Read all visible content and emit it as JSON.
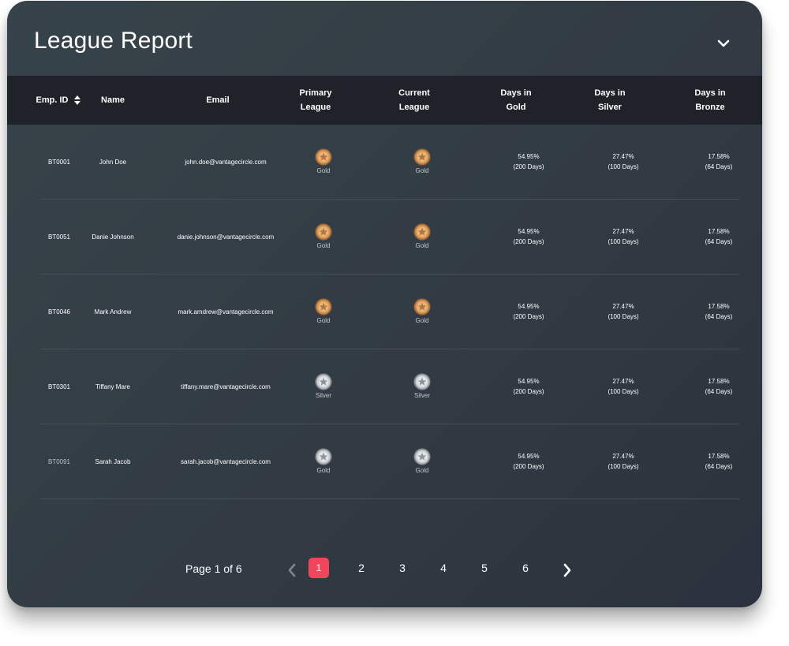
{
  "header": {
    "title": "League Report"
  },
  "columns": [
    {
      "label": "Emp. ID"
    },
    {
      "label": "Name"
    },
    {
      "label": "Email"
    },
    {
      "label": "Primary\nLeague"
    },
    {
      "label": "Current\nLeague"
    },
    {
      "label": "Days in\nGold"
    },
    {
      "label": "Days in\nSilver"
    },
    {
      "label": "Days in\nBronze"
    }
  ],
  "rows": [
    {
      "id": "BT0001",
      "name": "John Doe",
      "email": "john.doe@vantagecircle.com",
      "primary": "Gold",
      "primary_medal": "gold",
      "current": "Gold",
      "current_medal": "gold",
      "gold_pct": "54.95%",
      "gold_days": "(200 Days)",
      "silver_pct": "27.47%",
      "silver_days": "(100 Days)",
      "bronze_pct": "17.58%",
      "bronze_days": "(64 Days)"
    },
    {
      "id": "BT0051",
      "name": "Danie Johnson",
      "email": "danie.johnson@vantagecircle.com",
      "primary": "Gold",
      "primary_medal": "gold",
      "current": "Gold",
      "current_medal": "gold",
      "gold_pct": "54.95%",
      "gold_days": "(200 Days)",
      "silver_pct": "27.47%",
      "silver_days": "(100 Days)",
      "bronze_pct": "17.58%",
      "bronze_days": "(64 Days)"
    },
    {
      "id": "BT0046",
      "name": "Mark Andrew",
      "email": "mark.amdrew@vantagecircle.com",
      "primary": "Gold",
      "primary_medal": "gold",
      "current": "Gold",
      "current_medal": "gold",
      "gold_pct": "54.95%",
      "gold_days": "(200 Days)",
      "silver_pct": "27.47%",
      "silver_days": "(100 Days)",
      "bronze_pct": "17.58%",
      "bronze_days": "(64 Days)"
    },
    {
      "id": "BT0301",
      "name": "Tiffany Mare",
      "email": "tiffany.mare@vantagecircle.com",
      "primary": "Silver",
      "primary_medal": "silver",
      "current": "Silver",
      "current_medal": "silver",
      "gold_pct": "54.95%",
      "gold_days": "(200 Days)",
      "silver_pct": "27.47%",
      "silver_days": "(100 Days)",
      "bronze_pct": "17.58%",
      "bronze_days": "(64 Days)"
    },
    {
      "id": "BT0091",
      "name": "Sarah Jacob",
      "email": "sarah.jacob@vantagecircle.com",
      "primary": "Gold",
      "primary_medal": "silver",
      "current": "Gold",
      "current_medal": "silver",
      "gold_pct": "54.95%",
      "gold_days": "(200 Days)",
      "silver_pct": "27.47%",
      "silver_days": "(100 Days)",
      "bronze_pct": "17.58%",
      "bronze_days": "(64 Days)"
    }
  ],
  "pagination": {
    "summary": "Page 1 of 6",
    "pages": [
      "1",
      "2",
      "3",
      "4",
      "5",
      "6"
    ],
    "active": "1",
    "prev_icon": "chevron-left-icon",
    "next_icon": "chevron-right-icon"
  },
  "colors": {
    "accent": "#f0455a",
    "header_bg": "#1f2329",
    "gold": "#c98a4a",
    "silver": "#9a9fa5"
  }
}
